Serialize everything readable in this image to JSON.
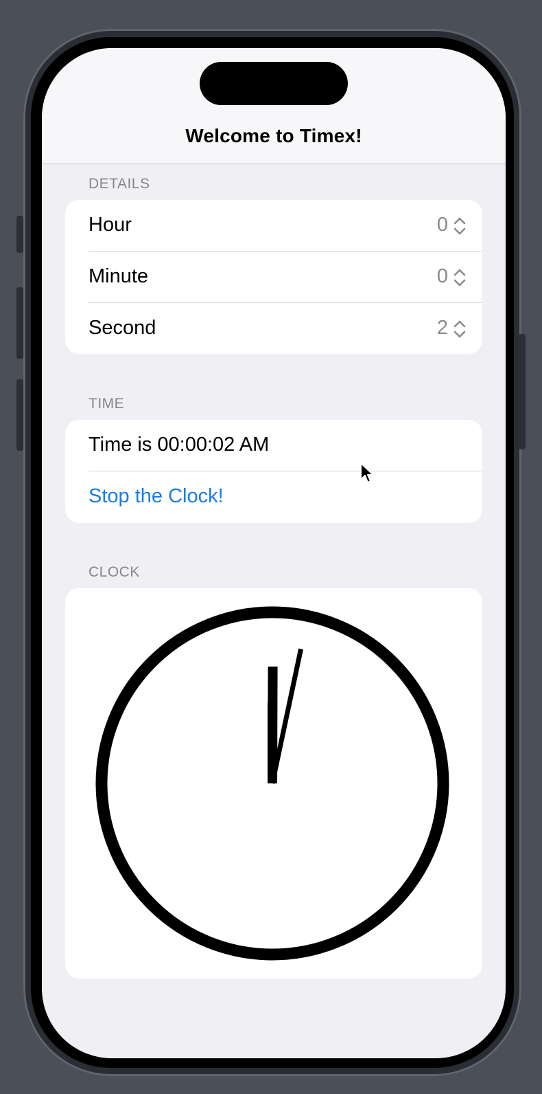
{
  "nav": {
    "title": "Welcome to Timex!"
  },
  "details": {
    "header": "DETAILS",
    "rows": [
      {
        "label": "Hour",
        "value": "0"
      },
      {
        "label": "Minute",
        "value": "0"
      },
      {
        "label": "Second",
        "value": "2"
      }
    ]
  },
  "time": {
    "header": "TIME",
    "display": "Time is 00:00:02 AM",
    "stop_button": "Stop the Clock!"
  },
  "clock": {
    "header": "CLOCK",
    "hour": 0,
    "minute": 0,
    "second": 2
  },
  "colors": {
    "accent": "#1a7be8",
    "background": "#efeff4",
    "card": "#ffffff",
    "secondary_text": "#8a8a8f"
  },
  "icons": {
    "stepper": "chevron-up-down-icon",
    "cursor": "mouse-pointer-icon"
  }
}
